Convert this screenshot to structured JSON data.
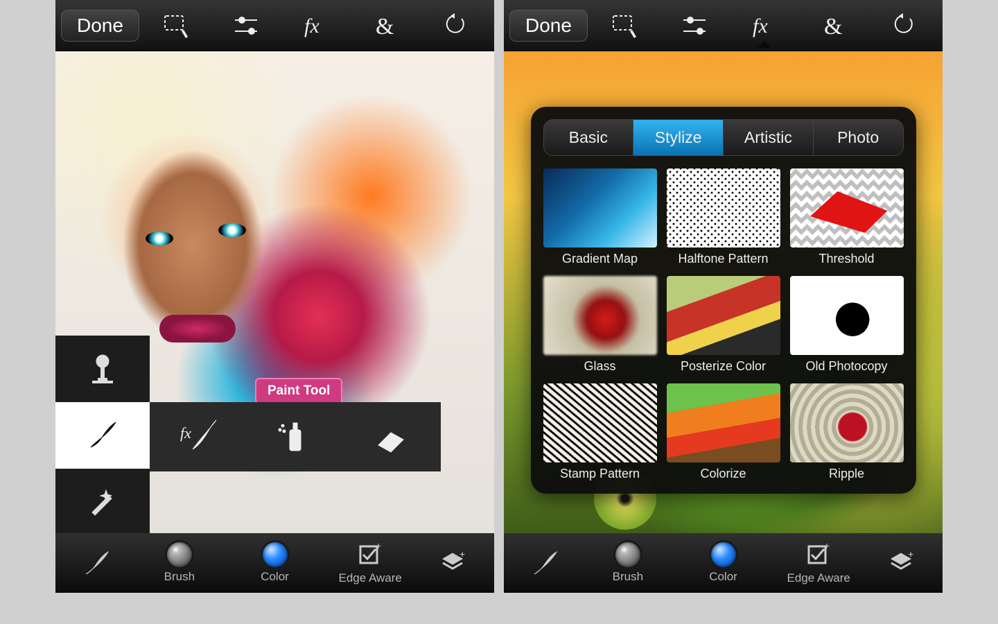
{
  "left": {
    "topbar": {
      "done_label": "Done"
    },
    "tooltip": "Paint Tool",
    "bottombar": {
      "brush_label": "Brush",
      "color_label": "Color",
      "edge_label": "Edge Aware"
    }
  },
  "right": {
    "topbar": {
      "done_label": "Done"
    },
    "bottombar": {
      "brush_label": "Brush",
      "color_label": "Color",
      "edge_label": "Edge Aware"
    },
    "fx": {
      "seg": {
        "basic": "Basic",
        "stylize": "Stylize",
        "artistic": "Artistic",
        "photo": "Photo",
        "selected": "Stylize"
      },
      "effects": [
        {
          "name": "Gradient Map",
          "thumb": "th-gradientmap"
        },
        {
          "name": "Halftone Pattern",
          "thumb": "th-halftone"
        },
        {
          "name": "Threshold",
          "thumb": "th-threshold"
        },
        {
          "name": "Glass",
          "thumb": "th-glass"
        },
        {
          "name": "Posterize Color",
          "thumb": "th-posterize"
        },
        {
          "name": "Old Photocopy",
          "thumb": "th-oldphoto"
        },
        {
          "name": "Stamp Pattern",
          "thumb": "th-stamp"
        },
        {
          "name": "Colorize",
          "thumb": "th-colorize"
        },
        {
          "name": "Ripple",
          "thumb": "th-ripple"
        }
      ]
    }
  }
}
